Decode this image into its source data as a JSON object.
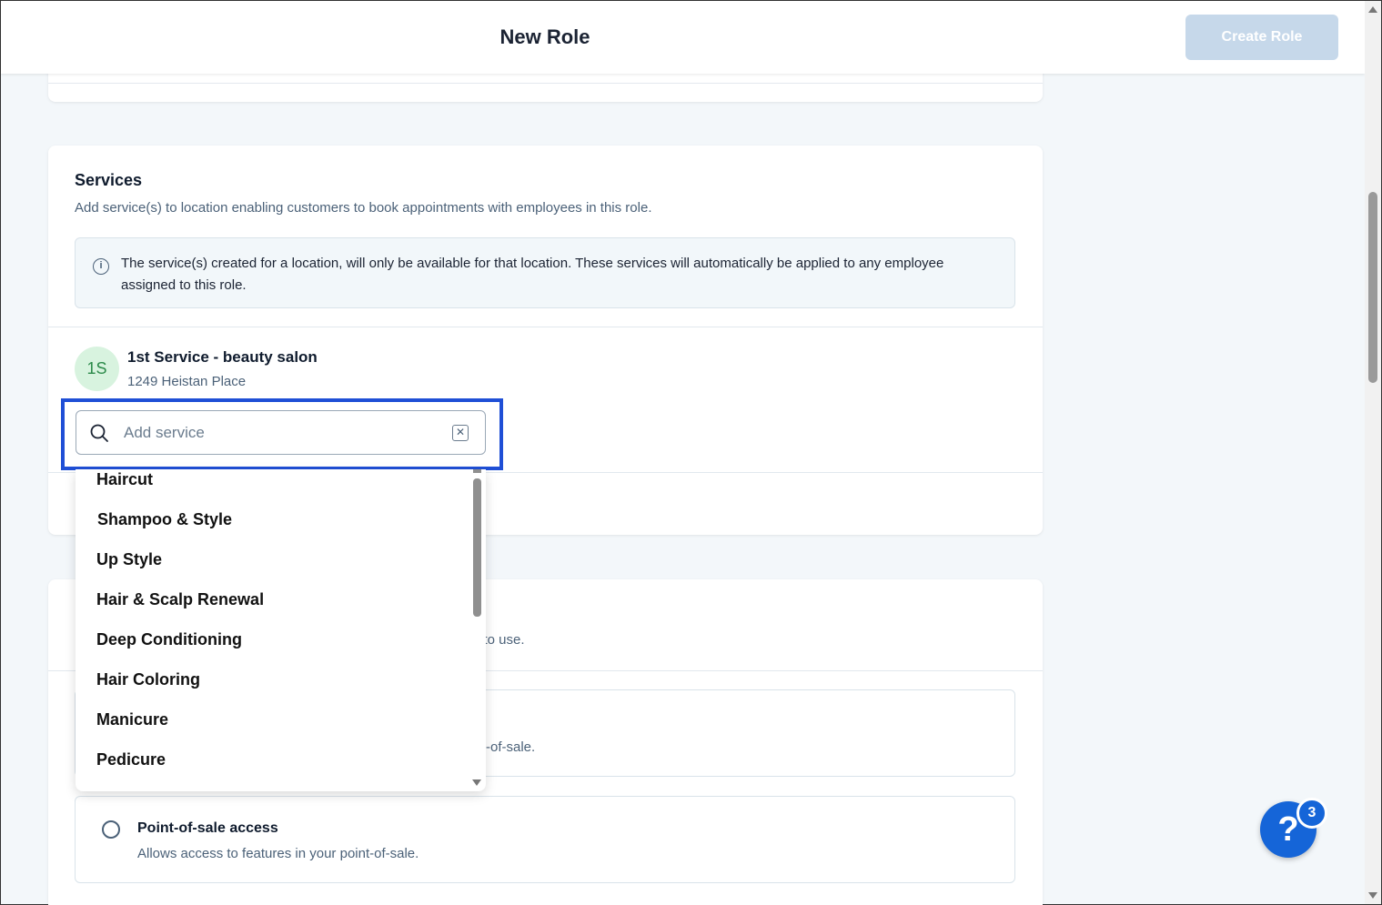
{
  "header": {
    "title": "New Role",
    "create_button": "Create Role"
  },
  "services": {
    "title": "Services",
    "description": "Add service(s) to location enabling customers to book appointments with employees in this role.",
    "info_text": "The service(s) created for a location, will only be available for that location. These services will automatically be applied to any employee assigned to this role.",
    "location": {
      "avatar": "1S",
      "name": "1st Service - beauty salon",
      "address": "1249 Heistan Place"
    },
    "search": {
      "placeholder": "Add service",
      "value": ""
    },
    "dropdown_items": [
      "Haircut",
      "Shampoo & Style",
      "Up Style",
      "Hair & Scalp Renewal",
      "Deep Conditioning",
      "Hair Coloring",
      "Manicure",
      "Pedicure"
    ]
  },
  "permissions": {
    "desc_fragment": "e to use.",
    "box1_fragment": "-of-sale.",
    "pos_access": {
      "title": "Point-of-sale access",
      "description": "Allows access to features in your point-of-sale."
    }
  },
  "help": {
    "icon_glyph": "?",
    "badge_count": "3"
  },
  "colors": {
    "accent": "#1565d8",
    "highlight": "#1f4fd6",
    "button_disabled": "#c6d8ea",
    "avatar_bg": "#d8f3df",
    "avatar_text": "#2c8a4a"
  }
}
